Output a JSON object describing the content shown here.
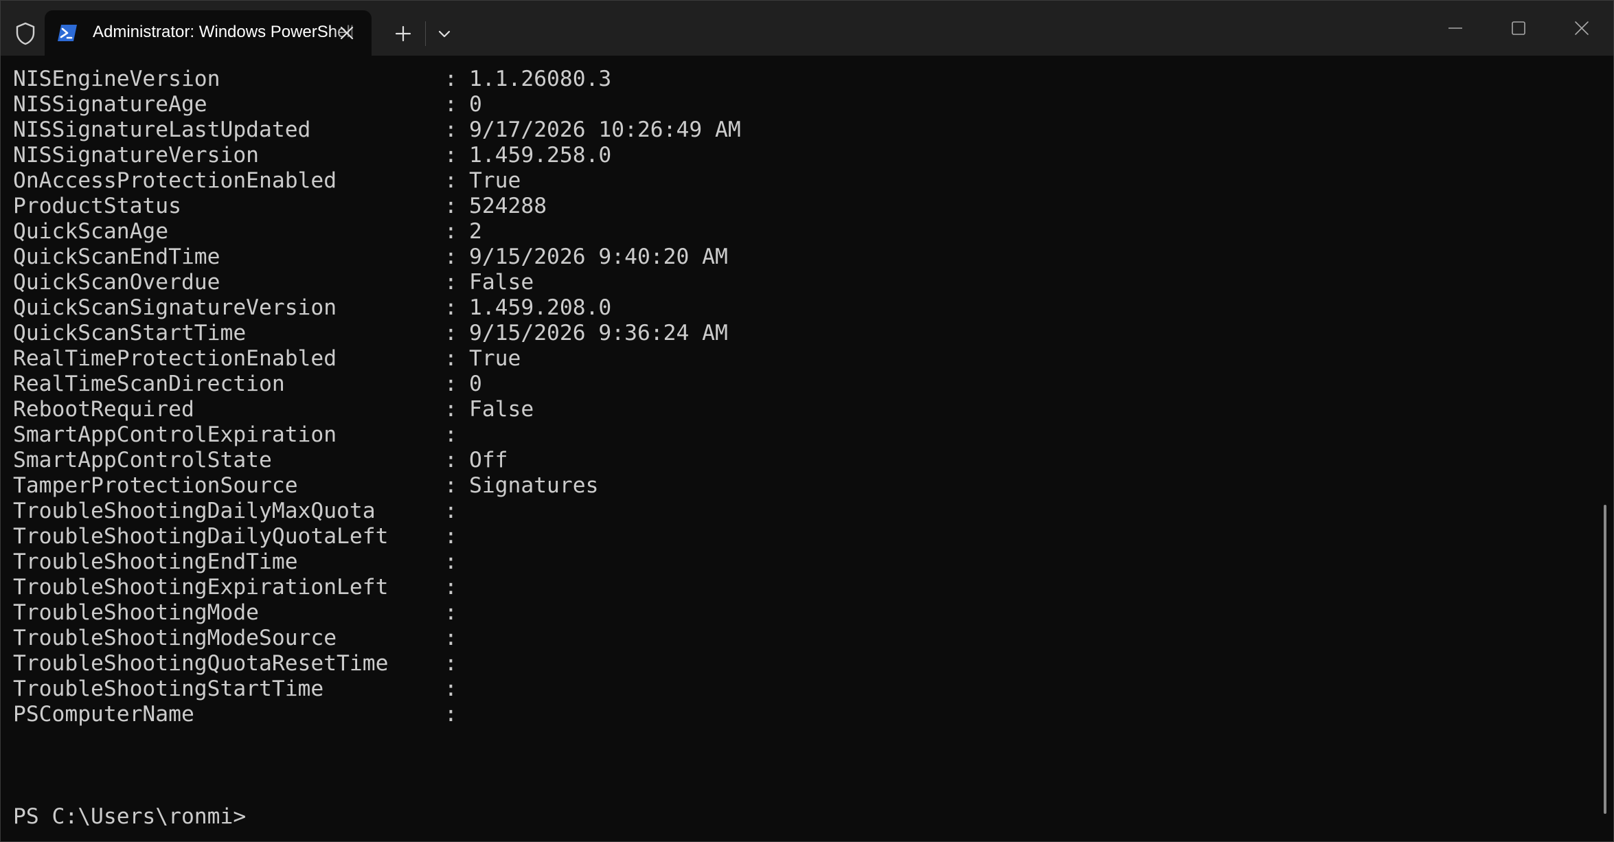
{
  "tab": {
    "title": "Administrator: Windows PowerShell",
    "icon": "powershell-icon"
  },
  "titlebar": {
    "shield_icon": "shield-icon",
    "new_tab_icon": "plus-icon",
    "dropdown_icon": "chevron-down-icon",
    "minimize_icon": "minimize-icon",
    "maximize_icon": "maximize-icon",
    "close_icon": "close-icon"
  },
  "colors": {
    "titlebar_bg": "#202020",
    "terminal_bg": "#0c0c0c",
    "terminal_fg": "#cccccc",
    "powershell_blue": "#2d6bd6"
  },
  "output": [
    {
      "key": "NISEngineVersion",
      "sep": ":",
      "value": "1.1.26080.3"
    },
    {
      "key": "NISSignatureAge",
      "sep": ":",
      "value": "0"
    },
    {
      "key": "NISSignatureLastUpdated",
      "sep": ":",
      "value": "9/17/2026 10:26:49 AM"
    },
    {
      "key": "NISSignatureVersion",
      "sep": ":",
      "value": "1.459.258.0"
    },
    {
      "key": "OnAccessProtectionEnabled",
      "sep": ":",
      "value": "True"
    },
    {
      "key": "ProductStatus",
      "sep": ":",
      "value": "524288"
    },
    {
      "key": "QuickScanAge",
      "sep": ":",
      "value": "2"
    },
    {
      "key": "QuickScanEndTime",
      "sep": ":",
      "value": "9/15/2026 9:40:20 AM"
    },
    {
      "key": "QuickScanOverdue",
      "sep": ":",
      "value": "False"
    },
    {
      "key": "QuickScanSignatureVersion",
      "sep": ":",
      "value": "1.459.208.0"
    },
    {
      "key": "QuickScanStartTime",
      "sep": ":",
      "value": "9/15/2026 9:36:24 AM"
    },
    {
      "key": "RealTimeProtectionEnabled",
      "sep": ":",
      "value": "True"
    },
    {
      "key": "RealTimeScanDirection",
      "sep": ":",
      "value": "0"
    },
    {
      "key": "RebootRequired",
      "sep": ":",
      "value": "False"
    },
    {
      "key": "SmartAppControlExpiration",
      "sep": ":",
      "value": ""
    },
    {
      "key": "SmartAppControlState",
      "sep": ":",
      "value": "Off"
    },
    {
      "key": "TamperProtectionSource",
      "sep": ":",
      "value": "Signatures"
    },
    {
      "key": "TroubleShootingDailyMaxQuota",
      "sep": ":",
      "value": ""
    },
    {
      "key": "TroubleShootingDailyQuotaLeft",
      "sep": ":",
      "value": ""
    },
    {
      "key": "TroubleShootingEndTime",
      "sep": ":",
      "value": ""
    },
    {
      "key": "TroubleShootingExpirationLeft",
      "sep": ":",
      "value": ""
    },
    {
      "key": "TroubleShootingMode",
      "sep": ":",
      "value": ""
    },
    {
      "key": "TroubleShootingModeSource",
      "sep": ":",
      "value": ""
    },
    {
      "key": "TroubleShootingQuotaResetTime",
      "sep": ":",
      "value": ""
    },
    {
      "key": "TroubleShootingStartTime",
      "sep": ":",
      "value": ""
    },
    {
      "key": "PSComputerName",
      "sep": ":",
      "value": ""
    }
  ],
  "prompt": "PS C:\\Users\\ronmi>"
}
